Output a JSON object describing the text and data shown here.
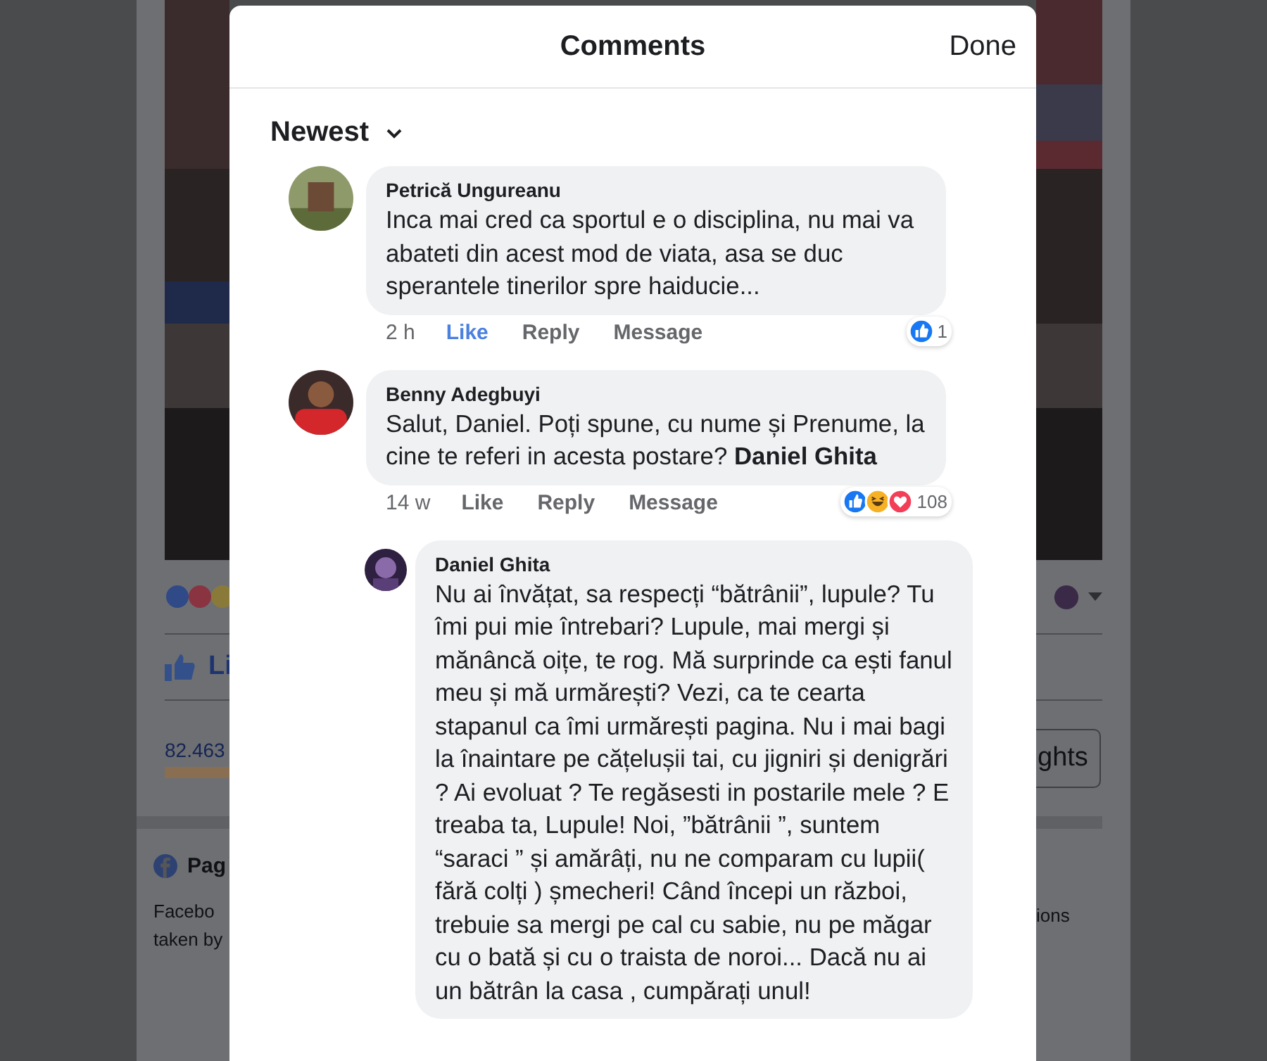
{
  "page_left": {
    "like_label": "Li",
    "stat": "82.463",
    "section_title": "Pag",
    "section_text": [
      "Facebo",
      "taken by"
    ]
  },
  "page_right": {
    "button_label": "ghts",
    "section_text": "ions"
  },
  "dialog": {
    "title": "Comments",
    "done": "Done",
    "sort": "Newest"
  },
  "comments": [
    {
      "kind": "comment",
      "author": "Petrică Ungureanu",
      "text": "Inca mai cred ca sportul e o disciplina, nu mai va abateti din acest mod de viata, asa se duc sperantele tinerilor spre haiducie...",
      "time": "2 h",
      "liked": true,
      "like": "Like",
      "reply": "Reply",
      "message": "Message",
      "reactions": [
        {
          "kind": "like"
        }
      ],
      "reaction_count": "1"
    },
    {
      "kind": "comment",
      "author": "Benny Adegbuyi",
      "text": "Salut, Daniel. Poți spune, cu nume și Prenume, la cine te referi in acesta postare? **Daniel Ghita**",
      "time": "14 w",
      "liked": false,
      "like": "Like",
      "reply": "Reply",
      "message": "Message",
      "reactions": [
        {
          "kind": "like"
        },
        {
          "kind": "haha"
        },
        {
          "kind": "love"
        }
      ],
      "reaction_count": "108"
    },
    {
      "kind": "reply",
      "author": "Daniel Ghita",
      "text": "Nu ai învățat, sa respecți “bătrânii”, lupule? Tu  îmi pui mie întrebari? Lupule, mai mergi și mănâncă oițe, te rog. Mă surprinde ca ești fanul meu și mă urmărești? Vezi, ca te cearta stapanul ca îmi urmărești pagina. Nu i mai bagi la înaintare pe cățelușii tai, cu jigniri și denigrări ? Ai evoluat ? Te regăsesti in postarile mele ? E treaba ta, Lupule! Noi, ”bătrânii ”, suntem “saraci ” și amărâți, nu ne comparam cu lupii( fără colți ) șmecheri! Când începi un război, trebuie sa mergi pe cal cu sabie, nu pe măgar cu o bată și cu o traista de noroi... Dacă nu ai un bătrân la casa , cumpărați unul!"
    }
  ]
}
